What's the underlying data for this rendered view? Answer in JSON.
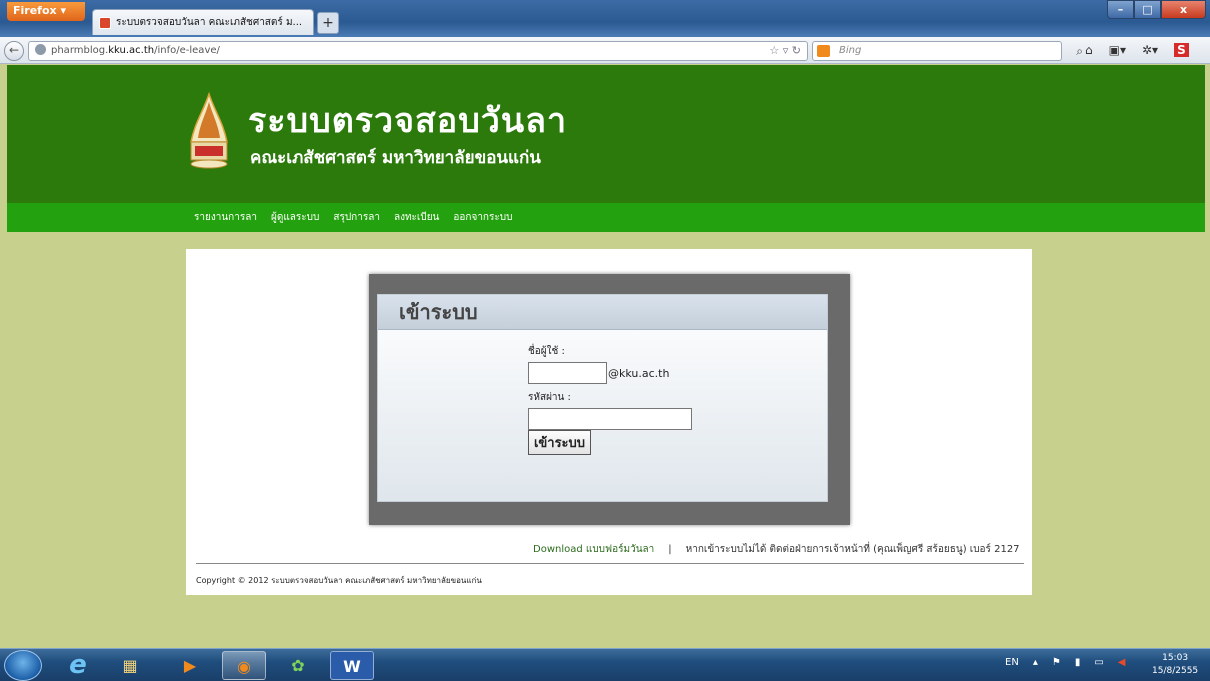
{
  "browser": {
    "app_button": "Firefox ▾",
    "tab_title": "ระบบตรวจสอบวันลา คณะเภสัชศาสตร์ ม...",
    "new_tab": "+",
    "url_prefix": "pharmblog.",
    "url_domain": "kku.ac.th",
    "url_path": "/info/e-leave/",
    "search_placeholder": "Bing",
    "window_controls": {
      "minimize": "–",
      "maximize": "□",
      "close": "x"
    }
  },
  "site": {
    "title": "ระบบตรวจสอบวันลา",
    "subtitle": "คณะเภสัชศาสตร์ มหาวิทยาลัยขอนแก่น"
  },
  "menu": [
    {
      "label": "รายงานการลา"
    },
    {
      "label": "ผู้ดูแลระบบ"
    },
    {
      "label": "สรุปการลา"
    },
    {
      "label": "ลงทะเบียน"
    },
    {
      "label": "ออกจากระบบ"
    }
  ],
  "login": {
    "heading": "เข้าระบบ",
    "username_label": "ชื่อผู้ใช้ :",
    "username_value": "",
    "username_suffix": "@kku.ac.th",
    "password_label": "รหัสผ่าน :",
    "password_value": "",
    "submit_label": "เข้าระบบ"
  },
  "footer": {
    "download_link": "Download แบบฟอร์มวันลา",
    "separator": "|",
    "contact": "หากเข้าระบบไม่ได้ ติดต่อฝ่ายการเจ้าหน้าที่ (คุณเพ็ญศรี สร้อยธนู) เบอร์ 2127",
    "copyright": "Copyright © 2012 ระบบตรวจสอบวันลา คณะเภสัชศาสตร์ มหาวิทยาลัยขอนแก่น"
  },
  "taskbar": {
    "apps": [
      {
        "name": "internet-explorer",
        "glyph": "e"
      },
      {
        "name": "file-explorer",
        "glyph": "▦"
      },
      {
        "name": "media-player",
        "glyph": "▶"
      },
      {
        "name": "firefox",
        "glyph": "◉"
      },
      {
        "name": "messenger",
        "glyph": "✿"
      },
      {
        "name": "word",
        "glyph": "W"
      }
    ],
    "language": "EN",
    "time": "15:03",
    "date": "15/8/2555"
  },
  "colors": {
    "header_bg": "#2c7a0c",
    "menu_bg": "#24a10e",
    "page_bg": "#c8d08e",
    "link_green": "#2c6b1c"
  }
}
